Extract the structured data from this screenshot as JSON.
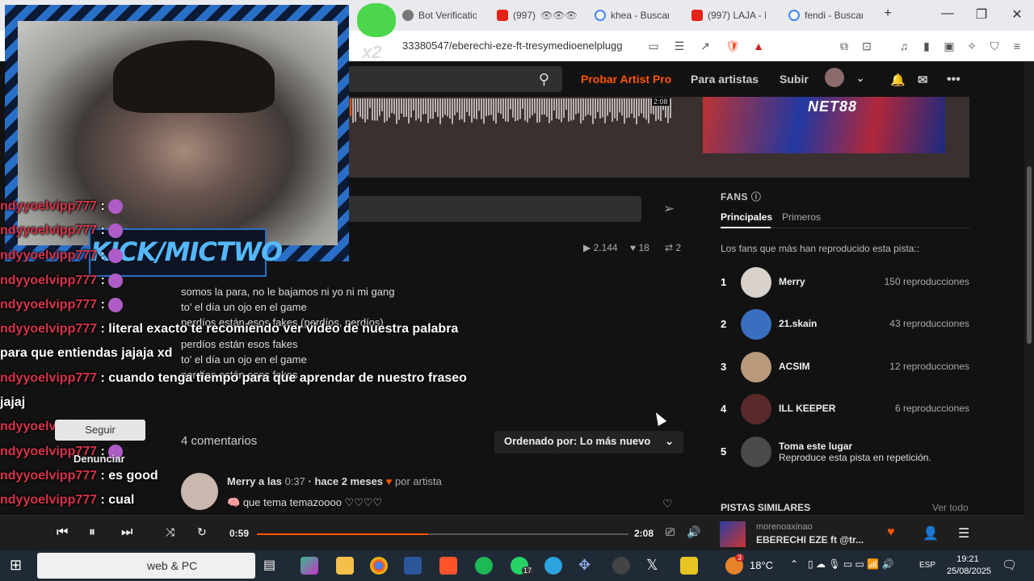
{
  "browser": {
    "tabs": [
      {
        "title": "Bot Verificatio",
        "favicon": "bot-icon"
      },
      {
        "title": "(997)",
        "favicon": "youtube-icon"
      },
      {
        "title": "khea - Buscar",
        "favicon": "google-icon"
      },
      {
        "title": "(997) LAJA - IN",
        "favicon": "youtube-icon"
      },
      {
        "title": "fendi - Buscar",
        "favicon": "google-icon"
      }
    ],
    "url": "33380547/eberechi-eze-ft-tresymedioenelplugg",
    "brave_badge": "2"
  },
  "header": {
    "probar": "Probar Artist Pro",
    "para_artistas": "Para artistas",
    "subir": "Subir"
  },
  "waveform": {
    "time": "2:08"
  },
  "hero_art_text": "NET88",
  "stats": {
    "plays": "2.144",
    "likes": "18",
    "reposts": "2"
  },
  "lyrics": [
    "somos la para, no le bajamos ni yo ni mi gang",
    "to' el día un ojo en el game",
    "perdíos están esos fakes (perdíos, perdíos)",
    "perdíos están esos fakes",
    "to' el día un ojo en el game",
    "perdíos están esos fakes"
  ],
  "comments": {
    "count_label": "4 comentarios",
    "sort_label": "Ordenado por: Lo más nuevo",
    "items": [
      {
        "user": "Merry",
        "at_prefix": "a las",
        "at_time": "0:37",
        "when": "· hace 2 meses",
        "by_artist": "por artista",
        "text": "que tema temazoooo ♡♡♡♡"
      }
    ]
  },
  "fans": {
    "title": "FANS",
    "tabs": [
      "Principales",
      "Primeros"
    ],
    "description": "Los fans que más han reproducido esta pista::",
    "list": [
      {
        "rank": "1",
        "name": "Merry",
        "plays": "150 reproducciones"
      },
      {
        "rank": "2",
        "name": "21.skain",
        "plays": "43 reproducciones"
      },
      {
        "rank": "3",
        "name": "ACSIM",
        "plays": "12 reproducciones"
      },
      {
        "rank": "4",
        "name": "ILL KEEPER",
        "plays": "6 reproducciones"
      }
    ],
    "placeholder": {
      "rank": "5",
      "name": "Toma este lugar",
      "sub": "Reproduce esta pista en repetición."
    }
  },
  "similar": {
    "title": "PISTAS SIMILARES",
    "ver_todo": "Ver todo"
  },
  "player": {
    "current": "0:59",
    "duration": "2:08",
    "progress": 0.46,
    "artist": "morenoaxinao",
    "title": "EBERECHI EZE ft @tr..."
  },
  "taskbar": {
    "search_text": "web & PC",
    "whatsapp_badge": "17",
    "weather": "18°C",
    "weather_badge": "3",
    "lang": "ESP",
    "time": "19:21",
    "date": "25/08/2025"
  },
  "overlay": {
    "channel": "KICK/MICTWO",
    "multiplier": "x2",
    "context_menu": {
      "seguir": "Seguir",
      "denunciar": "Denunciar"
    },
    "chat": [
      {
        "user": "ndyyoelvipp777",
        "sep": " :",
        "text": ""
      },
      {
        "user": "ndyyoelvipp777",
        "sep": " :",
        "text": ""
      },
      {
        "user": "ndyyoelvipp777",
        "sep": " :",
        "text": ""
      },
      {
        "user": "ndyyoelvipp777",
        "sep": " :",
        "text": ""
      },
      {
        "user": "ndyyoelvipp777",
        "sep": " :",
        "text": ""
      },
      {
        "user": "ndyyoelvipp777",
        "sep": " :",
        "text": " literal exacto te recomiendo ver video de nuestra palabra"
      },
      {
        "user": "",
        "sep": "",
        "text": "para que entiendas jajaja xd"
      },
      {
        "user": "ndyyoelvipp777",
        "sep": " :",
        "text": " cuando tenga tiempo para que aprendar de nuestro fraseo"
      },
      {
        "user": "",
        "sep": "",
        "text": "jajaj"
      },
      {
        "user": "ndyyoelvipp777",
        "sep": " :",
        "text": ""
      },
      {
        "user": "ndyyoelvipp777",
        "sep": " :",
        "text": ""
      },
      {
        "user": "ndyyoelvipp777",
        "sep": " :",
        "text": " es good"
      },
      {
        "user": "ndyyoelvipp777",
        "sep": " :",
        "text": " cual"
      }
    ]
  }
}
